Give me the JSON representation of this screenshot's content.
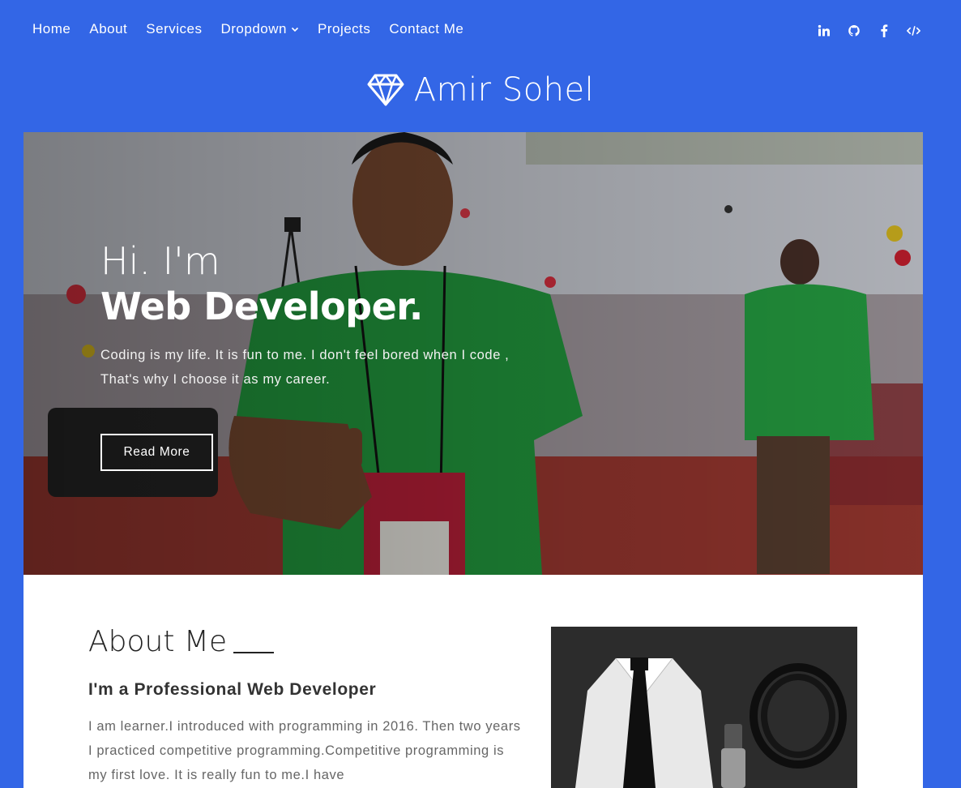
{
  "nav": {
    "items": [
      {
        "label": "Home"
      },
      {
        "label": "About"
      },
      {
        "label": "Services"
      },
      {
        "label": "Dropdown"
      },
      {
        "label": "Projects"
      },
      {
        "label": "Contact Me"
      }
    ],
    "social_icons": [
      "linkedin-icon",
      "github-icon",
      "facebook-icon",
      "code-icon"
    ]
  },
  "brand": {
    "name": "Amir Sohel",
    "icon": "diamond-icon"
  },
  "hero": {
    "greeting": "Hi. I'm",
    "role": "Web Developer.",
    "description_line1": "Coding is my life. It is fun to me. I don't feel bored when I code ,",
    "description_line2": "That's why I choose it as my career.",
    "button_label": "Read More"
  },
  "about": {
    "title": "About Me",
    "subtitle": "I'm a Professional Web Developer",
    "body": "I am learner.I introduced with programming in 2016. Then two years I practiced competitive programming.Competitive programming is my first love. It is really fun to me.I have"
  },
  "colors": {
    "brand_blue": "#3366e6",
    "white": "#ffffff"
  }
}
